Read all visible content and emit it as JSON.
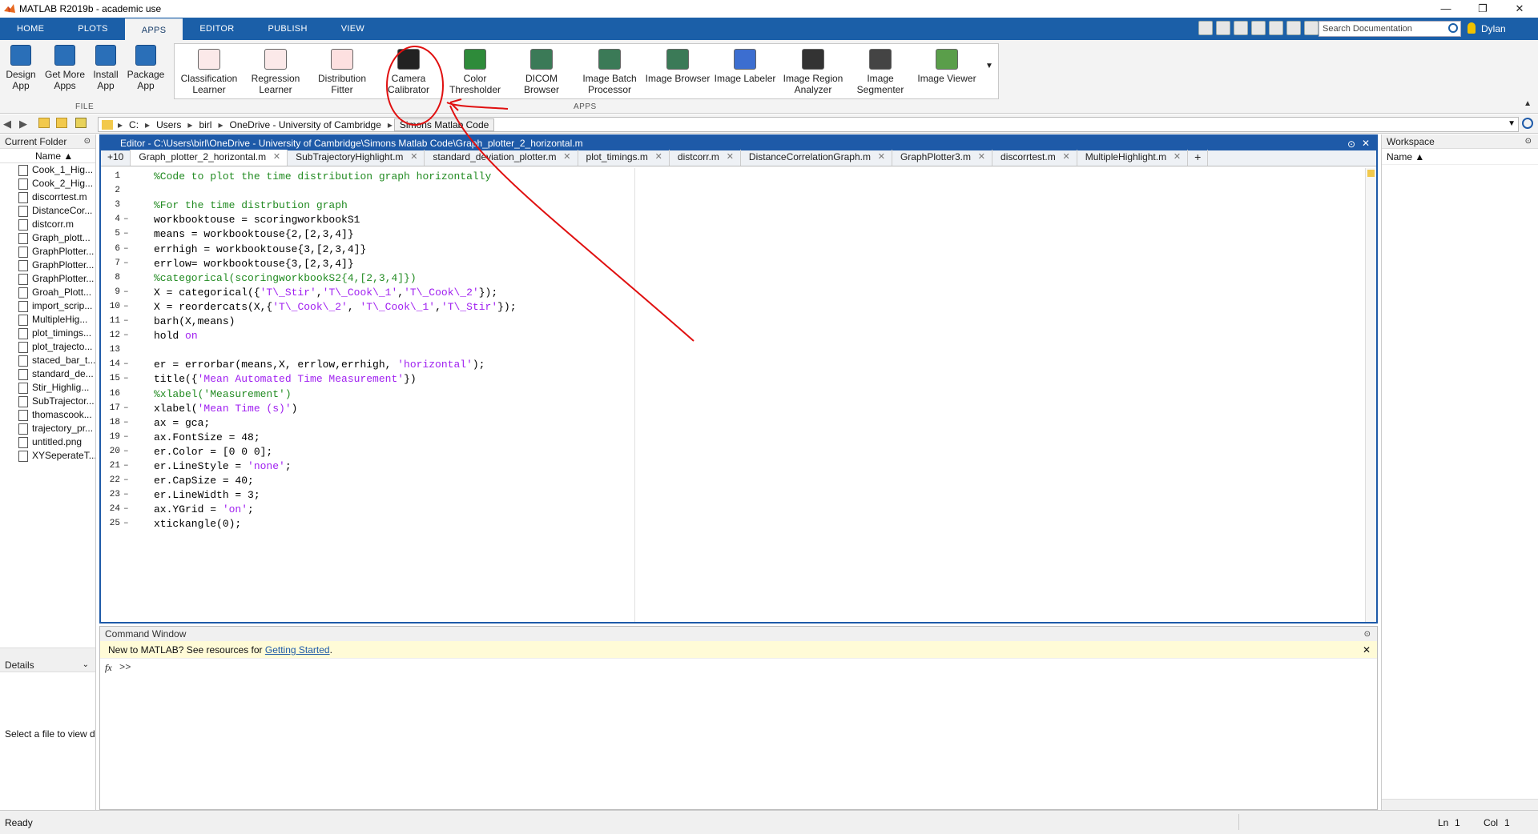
{
  "window": {
    "title": "MATLAB R2019b - academic use"
  },
  "tabs": [
    {
      "label": "HOME"
    },
    {
      "label": "PLOTS"
    },
    {
      "label": "APPS"
    },
    {
      "label": "EDITOR"
    },
    {
      "label": "PUBLISH"
    },
    {
      "label": "VIEW"
    }
  ],
  "search": {
    "placeholder": "Search Documentation"
  },
  "user": {
    "name": "Dylan"
  },
  "ribbon": {
    "file_buttons": [
      {
        "line1": "Design",
        "line2": "App"
      },
      {
        "line1": "Get More",
        "line2": "Apps"
      },
      {
        "line1": "Install",
        "line2": "App"
      },
      {
        "line1": "Package",
        "line2": "App"
      }
    ],
    "file_group": "FILE",
    "apps_group": "APPS",
    "apps": [
      {
        "line1": "Classification",
        "line2": "Learner"
      },
      {
        "line1": "Regression",
        "line2": "Learner"
      },
      {
        "line1": "Distribution",
        "line2": "Fitter"
      },
      {
        "line1": "Camera",
        "line2": "Calibrator"
      },
      {
        "line1": "Color",
        "line2": "Thresholder"
      },
      {
        "line1": "DICOM",
        "line2": "Browser"
      },
      {
        "line1": "Image Batch",
        "line2": "Processor"
      },
      {
        "line1": "Image Browser",
        "line2": ""
      },
      {
        "line1": "Image Labeler",
        "line2": ""
      },
      {
        "line1": "Image Region",
        "line2": "Analyzer"
      },
      {
        "line1": "Image",
        "line2": "Segmenter"
      },
      {
        "line1": "Image Viewer",
        "line2": ""
      }
    ]
  },
  "address": {
    "parts": [
      "C:",
      "Users",
      "birl",
      "OneDrive - University of Cambridge",
      "Simons Matlab Code"
    ]
  },
  "current_folder": {
    "title": "Current Folder",
    "column": "Name",
    "files": [
      "Cook_1_Hig...",
      "Cook_2_Hig...",
      "discorrtest.m",
      "DistanceCor...",
      "distcorr.m",
      "Graph_plott...",
      "GraphPlotter...",
      "GraphPlotter...",
      "GraphPlotter...",
      "Groah_Plott...",
      "import_scrip...",
      "MultipleHig...",
      "plot_timings...",
      "plot_trajecto...",
      "staced_bar_t...",
      "standard_de...",
      "Stir_Highlig...",
      "SubTrajector...",
      "thomascook...",
      "trajectory_pr...",
      "untitled.png",
      "XYSeperateT..."
    ]
  },
  "details": {
    "title": "Details",
    "text": "Select a file to view d"
  },
  "editor": {
    "title": "Editor - C:\\Users\\birl\\OneDrive - University of Cambridge\\Simons Matlab Code\\Graph_plotter_2_horizontal.m",
    "overflow": "+10",
    "tabs": [
      "Graph_plotter_2_horizontal.m",
      "SubTrajectoryHighlight.m",
      "standard_deviation_plotter.m",
      "plot_timings.m",
      "distcorr.m",
      "DistanceCorrelationGraph.m",
      "GraphPlotter3.m",
      "discorrtest.m",
      "MultipleHighlight.m"
    ],
    "add": "+",
    "lines": [
      "%Code to plot the time distribution graph horizontally",
      "",
      "%For the time distrbution graph",
      "workbooktouse = scoringworkbookS1",
      "means = workbooktouse{2,[2,3,4]}",
      "errhigh = workbooktouse{3,[2,3,4]}",
      "errlow= workbooktouse{3,[2,3,4]}",
      "%categorical(scoringworkbookS2{4,[2,3,4]})",
      "X = categorical({'T\\_Stir','T\\_Cook\\_1','T\\_Cook\\_2'});",
      "X = reordercats(X,{'T\\_Cook\\_2', 'T\\_Cook\\_1','T\\_Stir'});",
      "barh(X,means)",
      "hold on",
      "",
      "er = errorbar(means,X, errlow,errhigh, 'horizontal');",
      "title({'Mean Automated Time Measurement'})",
      "%xlabel('Measurement')",
      "xlabel('Mean Time (s)')",
      "ax = gca;",
      "ax.FontSize = 48;",
      "er.Color = [0 0 0];",
      "er.LineStyle = 'none';",
      "er.CapSize = 40;",
      "er.LineWidth = 3;",
      "ax.YGrid = 'on';",
      "xtickangle(0);"
    ]
  },
  "command_window": {
    "title": "Command Window",
    "notice_prefix": "New to MATLAB? See resources for ",
    "notice_link": "Getting Started",
    "notice_suffix": ".",
    "prompt_icon": "fx",
    "prompt": ">>"
  },
  "workspace": {
    "title": "Workspace",
    "column": "Name"
  },
  "status": {
    "text": "Ready",
    "ln_label": "Ln",
    "ln": "1",
    "col_label": "Col",
    "col": "1"
  },
  "colors": {
    "accent": "#1e5aa8",
    "annotation": "#e01010"
  }
}
